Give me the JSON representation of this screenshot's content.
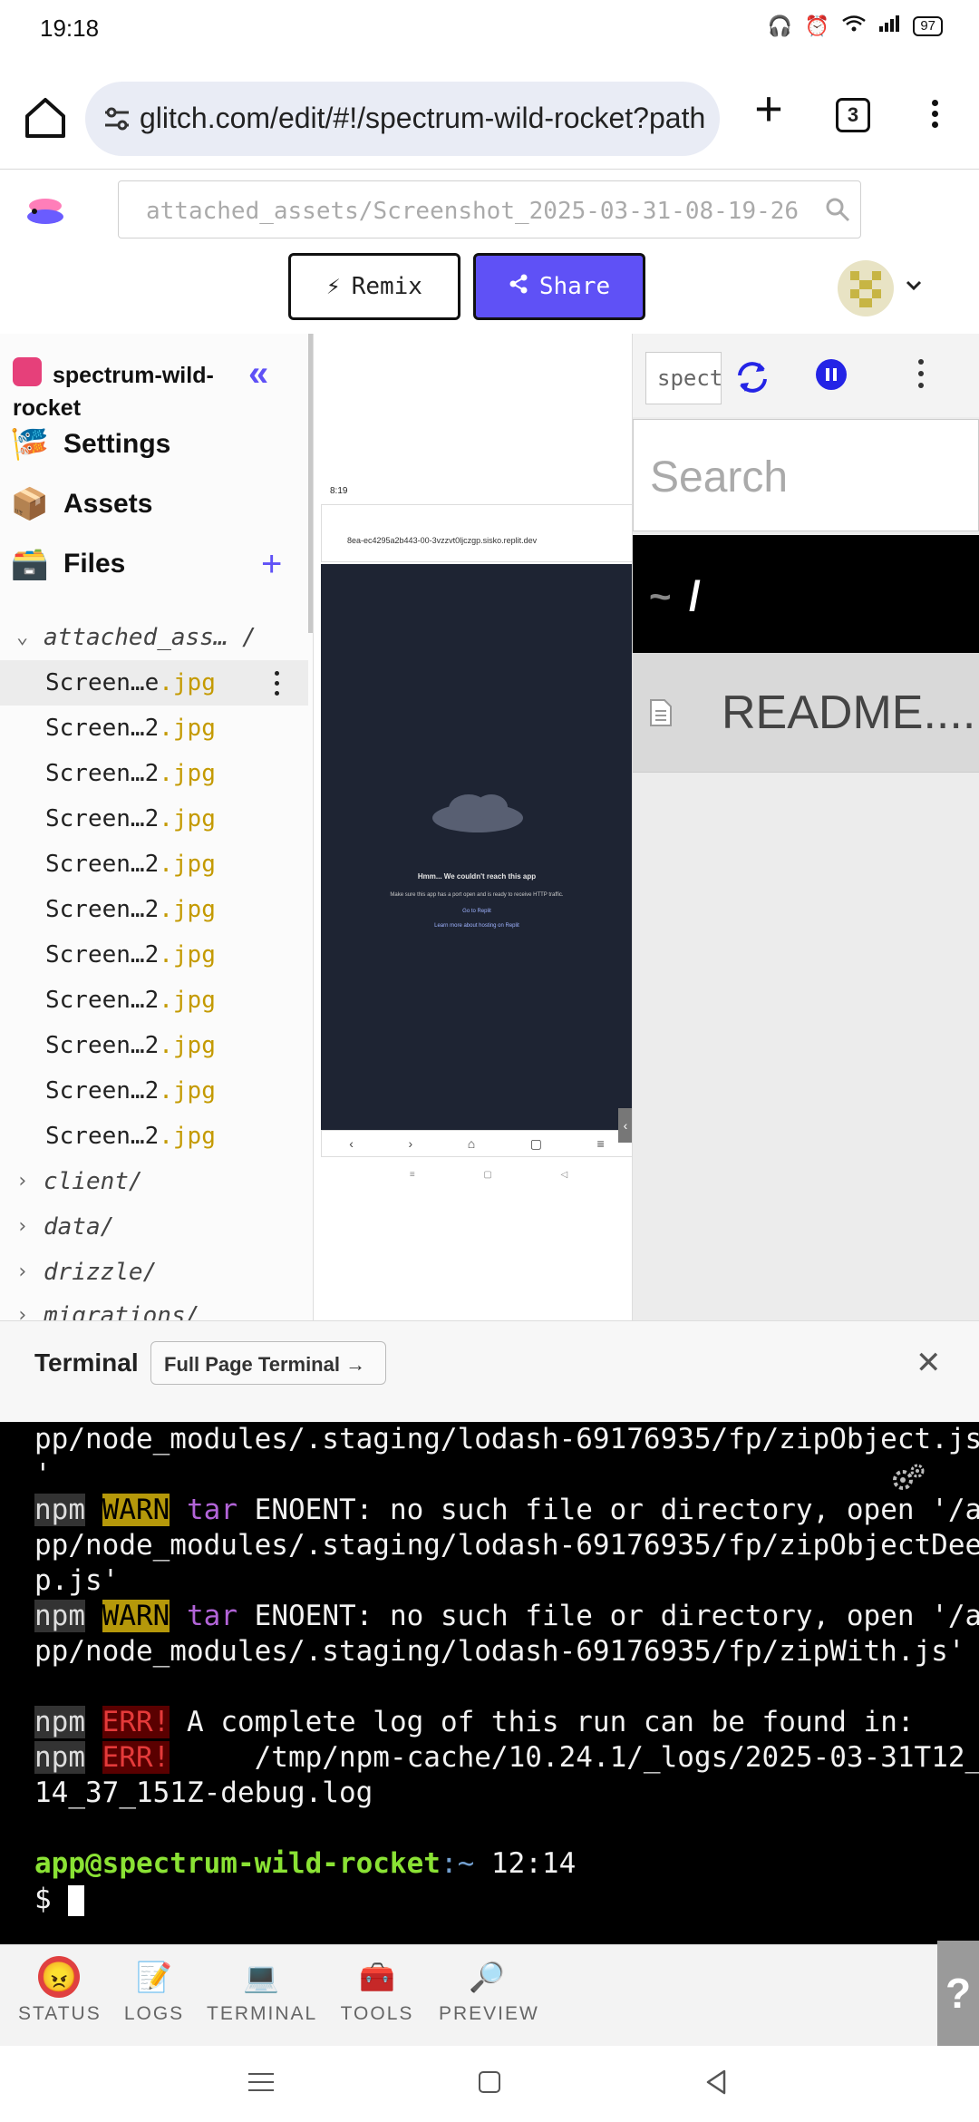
{
  "status_bar": {
    "time": "19:18",
    "battery": "97"
  },
  "browser": {
    "url": "glitch.com/edit/#!/spectrum-wild-rocket?path",
    "tab_count": "3"
  },
  "glitch_header": {
    "search_value": "attached_assets/Screenshot_2025-03-31-08-19-26",
    "remix_label": "Remix",
    "share_label": "Share",
    "share_color": "#5f51f6"
  },
  "sidebar": {
    "project_name": "spectrum-wild-rocket",
    "collapse_glyph": "«",
    "items": [
      {
        "label": "Settings",
        "icon": "settings-icon"
      },
      {
        "label": "Assets",
        "icon": "assets-box-icon"
      },
      {
        "label": "Files",
        "icon": "files-cabinet-icon"
      }
    ],
    "open_folder": "attached_ass… /",
    "files": [
      {
        "name": "Screen…e",
        "ext": ".jpg"
      },
      {
        "name": "Screen…2",
        "ext": ".jpg"
      },
      {
        "name": "Screen…2",
        "ext": ".jpg"
      },
      {
        "name": "Screen…2",
        "ext": ".jpg"
      },
      {
        "name": "Screen…2",
        "ext": ".jpg"
      },
      {
        "name": "Screen…2",
        "ext": ".jpg"
      },
      {
        "name": "Screen…2",
        "ext": ".jpg"
      },
      {
        "name": "Screen…2",
        "ext": ".jpg"
      },
      {
        "name": "Screen…2",
        "ext": ".jpg"
      },
      {
        "name": "Screen…2",
        "ext": ".jpg"
      },
      {
        "name": "Screen…2",
        "ext": ".jpg"
      }
    ],
    "folders": [
      "client/",
      "data/",
      "drizzle/",
      "migrations/"
    ]
  },
  "preview": {
    "status_time": "8:19",
    "url": "8ea-ec4295a2b443-00-3vzzvt0ljczgp.sisko.replit.dev",
    "msg_title": "Hmm... We couldn't reach this app",
    "msg_body": "Make sure this app has a port open and is ready to receive HTTP traffic.",
    "msg_link1": "Go to Replit",
    "msg_link2": "Learn more about hosting on Replit"
  },
  "right_pane": {
    "input_value": "spectrum-wild-rocket",
    "search_placeholder": "Search",
    "path_tilde": "~",
    "path_slash": "/",
    "file_name": "README...."
  },
  "terminal": {
    "title": "Terminal",
    "full_page_label": "Full Page Terminal →",
    "line1": "pp/node_modules/.staging/lodash-69176935/fp/zipObject.js",
    "line2": "'",
    "npm": "npm",
    "warn": "WARN",
    "err": "ERR!",
    "tar": "tar",
    "warn1_rest": " ENOENT: no such file or directory, open '/a",
    "warn1_l2": "pp/node_modules/.staging/lodash-69176935/fp/zipObjectDee",
    "warn1_l3": "p.js'",
    "warn2_rest": " ENOENT: no such file or directory, open '/a",
    "warn2_l2": "pp/node_modules/.staging/lodash-69176935/fp/zipWith.js'",
    "err1_rest": " A complete log of this run can be found in:",
    "err2_rest": "     /tmp/npm-cache/10.24.1/_logs/2025-03-31T12_",
    "err2_l2": "14_37_151Z-debug.log",
    "prompt_user": "app@spectrum-wild-rocket",
    "prompt_path": ":~",
    "prompt_time": " 12:14",
    "prompt_dollar": "$ "
  },
  "tabbar": {
    "tabs": [
      {
        "label": "STATUS",
        "icon": "status-face-icon"
      },
      {
        "label": "LOGS",
        "icon": "logs-memo-icon"
      },
      {
        "label": "TERMINAL",
        "icon": "terminal-laptop-icon"
      },
      {
        "label": "TOOLS",
        "icon": "toolbox-icon"
      },
      {
        "label": "PREVIEW",
        "icon": "magnifier-icon"
      }
    ],
    "help": "?"
  }
}
